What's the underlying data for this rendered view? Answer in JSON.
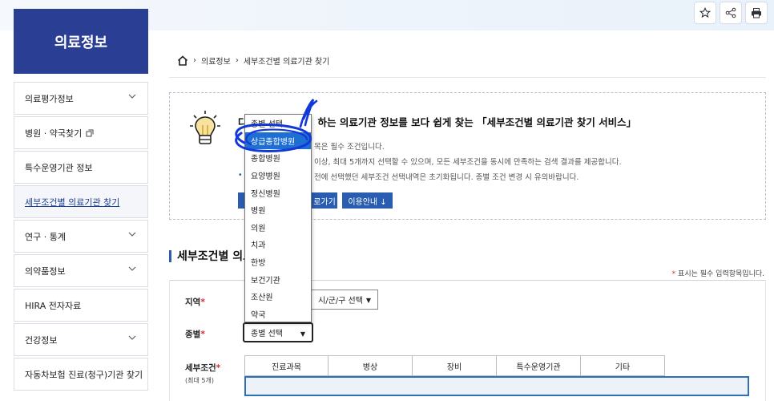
{
  "sidebar": {
    "title": "의료정보",
    "items": [
      {
        "label": "의료평가정보",
        "chevron": true
      },
      {
        "label": "병원 · 약국찾기",
        "external": true
      },
      {
        "label": "특수운영기관 정보"
      },
      {
        "label": "세부조건별 의료기관 찾기",
        "active": true
      },
      {
        "label": "연구 · 통계",
        "chevron": true
      },
      {
        "label": "의약품정보",
        "chevron": true
      },
      {
        "label": "HIRA 전자자료"
      },
      {
        "label": "건강정보",
        "chevron": true
      },
      {
        "label": "자동차보험 진료(청구)기관 찾기"
      }
    ]
  },
  "breadcrumb": {
    "home_icon": "home-icon",
    "level1": "의료정보",
    "level2": "세부조건별 의료기관 찾기"
  },
  "toolbar": {
    "icons": [
      "star-icon",
      "share-icon",
      "print-icon"
    ]
  },
  "info": {
    "title_prefix": "다",
    "title_rest": "하는 의료기관 정보를 보다 쉽게 찾는 「세부조건별 의료기관 찾기 서비스」",
    "line1": "목은 필수 조건입니다.",
    "line2": "이상, 최대 5개까지 선택할 수 있으며, 모든 세부조건을 동시에 만족하는 검색 결과를 제공합니다.",
    "line3": "전에 선택했던 세부조건 선택내역은 초기화됩니다. 종별 조건 변경 시 유의바랍니다.",
    "btn1": "로가기",
    "btn2": "이용안내 ↓"
  },
  "section": {
    "title": "세부조건별 의료",
    "required_note": "표시는 필수 입력항목입니다.",
    "required_star": "*"
  },
  "form": {
    "region_label": "지역",
    "district_select": "시/군/구 선택",
    "type_label": "종별",
    "type_select": "종별 선택",
    "cond_label": "세부조건",
    "cond_sub": "(최대 5개)",
    "required_star": "*",
    "tabs": [
      "진료과목",
      "병상",
      "장비",
      "특수운영기관",
      "기타"
    ]
  },
  "dropdown": {
    "options": [
      "종별 선택",
      "상급종합병원",
      "종합병원",
      "요양병원",
      "정신병원",
      "병원",
      "의원",
      "치과",
      "한방",
      "보건기관",
      "조산원",
      "약국"
    ],
    "selected_index": 1
  },
  "colors": {
    "brand": "#2a3f93",
    "accent": "#2a5cb0",
    "selected": "#1e6fd4",
    "required": "#e0262b",
    "scribble": "#1238d8"
  }
}
